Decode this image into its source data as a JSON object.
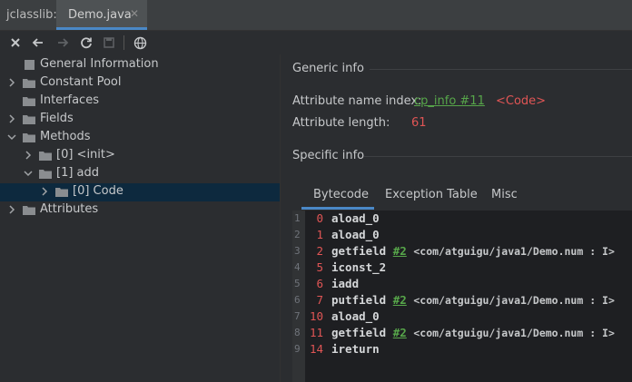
{
  "tabs": {
    "plugin_tab": "jclasslib:",
    "file_tab": "Demo.java",
    "close_glyph": "✕"
  },
  "toolbar": {
    "icons": [
      "close-icon",
      "back-icon",
      "forward-icon",
      "refresh-icon",
      "save-icon",
      "web-icon"
    ]
  },
  "tree": {
    "items": [
      {
        "label": "General Information",
        "depth": 0,
        "expandable": false,
        "expanded": false
      },
      {
        "label": "Constant Pool",
        "depth": 0,
        "expandable": true,
        "expanded": false
      },
      {
        "label": "Interfaces",
        "depth": 0,
        "expandable": false,
        "expanded": false
      },
      {
        "label": "Fields",
        "depth": 0,
        "expandable": true,
        "expanded": false
      },
      {
        "label": "Methods",
        "depth": 0,
        "expandable": true,
        "expanded": true
      },
      {
        "label": "[0] <init>",
        "depth": 1,
        "expandable": true,
        "expanded": false
      },
      {
        "label": "[1] add",
        "depth": 1,
        "expandable": true,
        "expanded": true
      },
      {
        "label": "[0] Code",
        "depth": 2,
        "expandable": true,
        "expanded": false,
        "selected": true
      },
      {
        "label": "Attributes",
        "depth": 0,
        "expandable": true,
        "expanded": false
      }
    ]
  },
  "generic": {
    "title": "Generic info",
    "name_index_label": "Attribute name index:",
    "name_index_link": "cp_info #11",
    "name_index_value": "<Code>",
    "length_label": "Attribute length:",
    "length_value": "61"
  },
  "specific": {
    "title": "Specific info",
    "tabs": [
      "Bytecode",
      "Exception Table",
      "Misc"
    ],
    "active_tab": "Bytecode"
  },
  "bytecode": [
    {
      "line": "1",
      "offset": "0",
      "op": "aload_0",
      "ref": "",
      "comment": ""
    },
    {
      "line": "2",
      "offset": "1",
      "op": "aload_0",
      "ref": "",
      "comment": ""
    },
    {
      "line": "3",
      "offset": "2",
      "op": "getfield",
      "ref": "#2",
      "comment": "<com/atguigu/java1/Demo.num : I>"
    },
    {
      "line": "4",
      "offset": "5",
      "op": "iconst_2",
      "ref": "",
      "comment": ""
    },
    {
      "line": "5",
      "offset": "6",
      "op": "iadd",
      "ref": "",
      "comment": ""
    },
    {
      "line": "6",
      "offset": "7",
      "op": "putfield",
      "ref": "#2",
      "comment": "<com/atguigu/java1/Demo.num : I>"
    },
    {
      "line": "7",
      "offset": "10",
      "op": "aload_0",
      "ref": "",
      "comment": ""
    },
    {
      "line": "8",
      "offset": "11",
      "op": "getfield",
      "ref": "#2",
      "comment": "<com/atguigu/java1/Demo.num : I>"
    },
    {
      "line": "9",
      "offset": "14",
      "op": "ireturn",
      "ref": "",
      "comment": ""
    }
  ]
}
